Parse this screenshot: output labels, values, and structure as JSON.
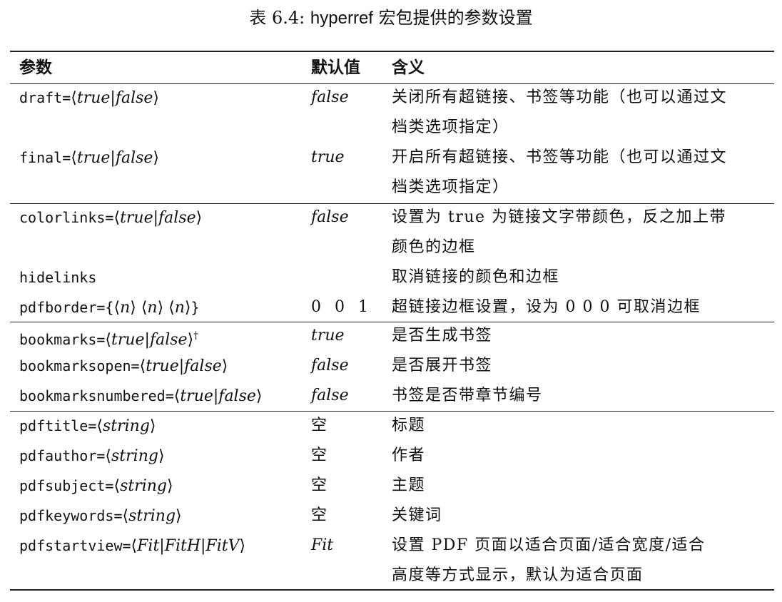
{
  "caption": {
    "number": "表 6.4:",
    "package": "hyperref",
    "text": "宏包提供的参数设置"
  },
  "headers": {
    "param": "参数",
    "default": "默认值",
    "meaning": "含义"
  },
  "rows": [
    {
      "key": "draft",
      "vals": "true|false",
      "default": "false",
      "meaning": [
        "关闭所有超链接、书签等功能（也可以通过文",
        "档类选项指定）"
      ]
    },
    {
      "key": "final",
      "vals": "true|false",
      "default": "true",
      "meaning": [
        "开启所有超链接、书签等功能（也可以通过文",
        "档类选项指定）"
      ]
    },
    {
      "key": "colorlinks",
      "vals": "true|false",
      "default": "false",
      "meaning": [
        "设置为 true 为链接文字带颜色，反之加上带",
        "颜色的边框"
      ]
    },
    {
      "key": "hidelinks",
      "vals": "",
      "default": "",
      "meaning": [
        "取消链接的颜色和边框"
      ]
    },
    {
      "key": "pdfborder",
      "vals": "n n n",
      "default": "0 0 1",
      "meaning": [
        "超链接边框设置，设为 0 0 0 可取消边框"
      ]
    },
    {
      "key": "bookmarks",
      "vals": "true|false",
      "note": "†",
      "default": "true",
      "meaning": [
        "是否生成书签"
      ]
    },
    {
      "key": "bookmarksopen",
      "vals": "true|false",
      "default": "false",
      "meaning": [
        "是否展开书签"
      ]
    },
    {
      "key": "bookmarksnumbered",
      "vals": "true|false",
      "default": "false",
      "meaning": [
        "书签是否带章节编号"
      ]
    },
    {
      "key": "pdftitle",
      "vals": "string",
      "default": "空",
      "meaning": [
        "标题"
      ]
    },
    {
      "key": "pdfauthor",
      "vals": "string",
      "default": "空",
      "meaning": [
        "作者"
      ]
    },
    {
      "key": "pdfsubject",
      "vals": "string",
      "default": "空",
      "meaning": [
        "主题"
      ]
    },
    {
      "key": "pdfkeywords",
      "vals": "string",
      "default": "空",
      "meaning": [
        "关键词"
      ]
    },
    {
      "key": "pdfstartview",
      "vals": "Fit|FitH|FitV",
      "default": "Fit",
      "meaning": [
        "设置 PDF 页面以适合页面/适合宽度/适合",
        "高度等方式显示，默认为适合页面"
      ]
    }
  ]
}
